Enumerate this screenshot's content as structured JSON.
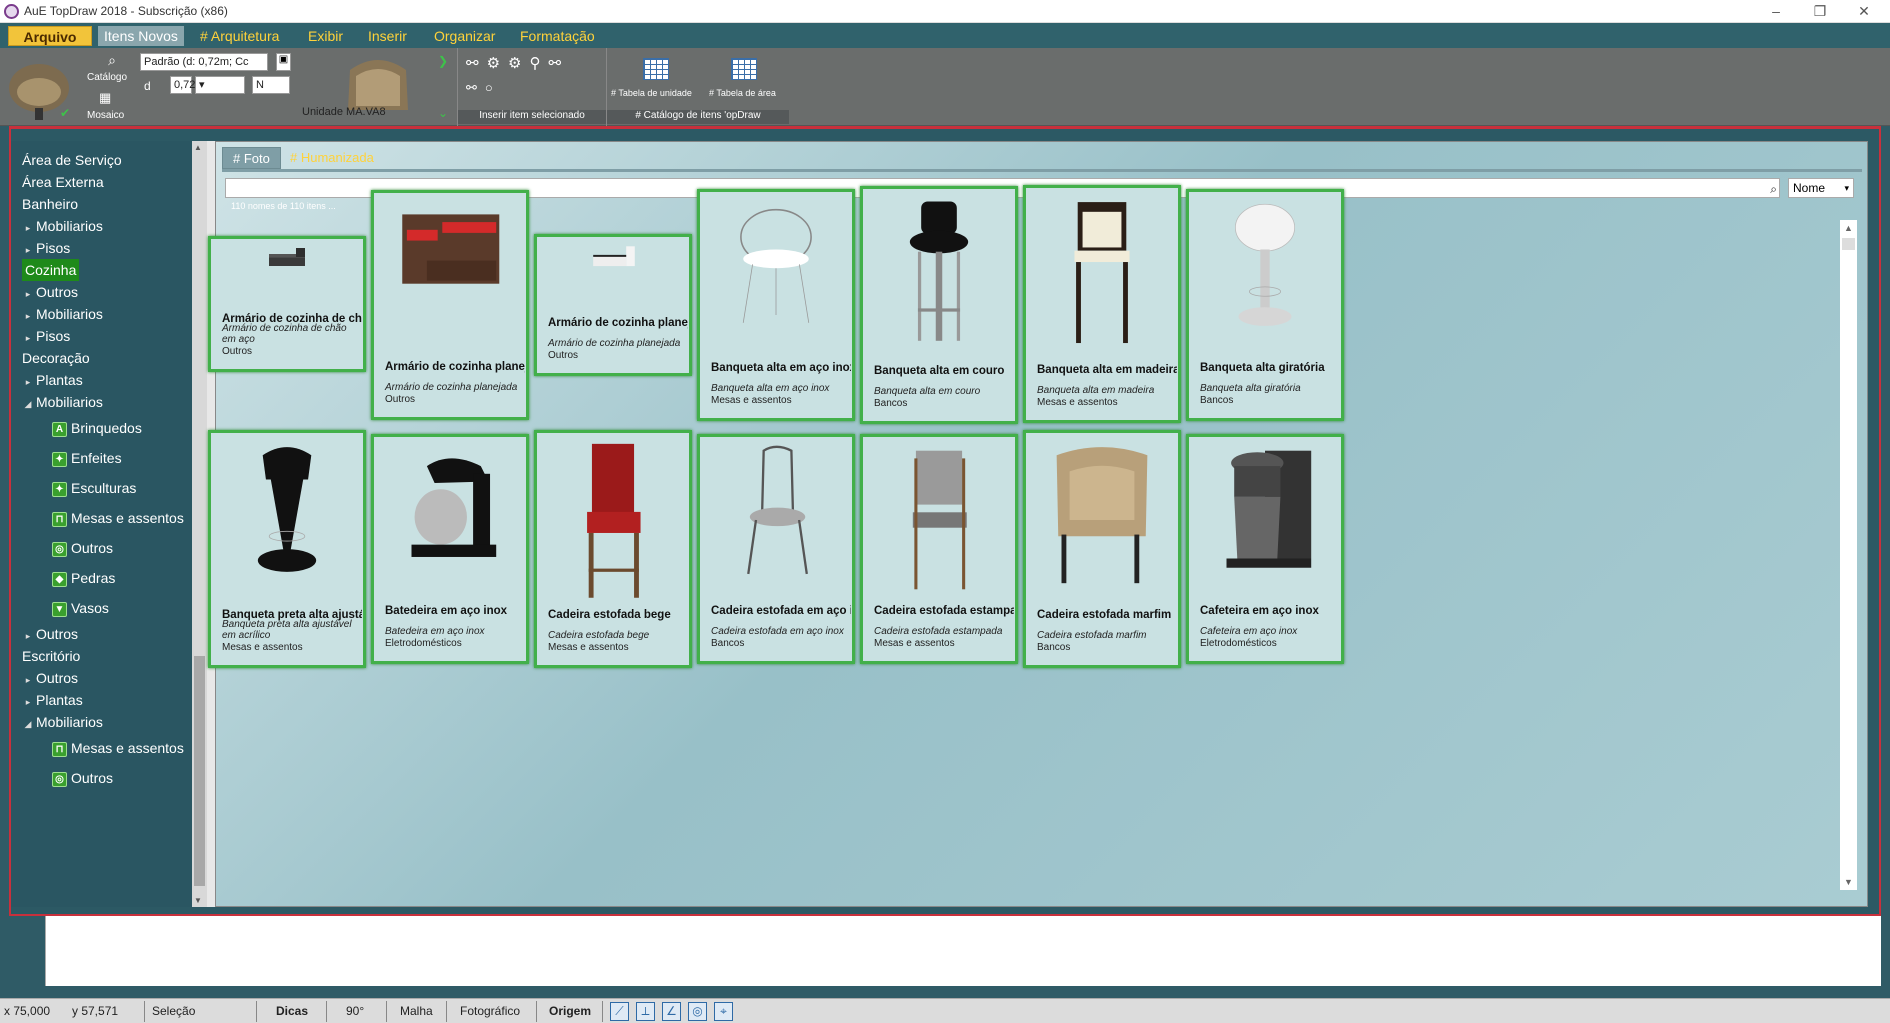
{
  "window": {
    "title": "AuE TopDraw 2018 - Subscrição (x86)",
    "controls": [
      "–",
      "❐",
      "✕"
    ]
  },
  "menu": {
    "items": [
      "Arquivo",
      "Itens Novos",
      "# Arquitetura",
      "Exibir",
      "Inserir",
      "Organizar",
      "Formatação"
    ]
  },
  "quick_access": "↶↷⟳▣ ?",
  "ribbon": {
    "catalog_label": "Catálogo",
    "mosaic_label": "Mosaico",
    "style_combo": "Padrão (d: 0,72m; Cc",
    "d_label": "d",
    "d_value": "0,72",
    "n_value": "N",
    "unit_label": "Unidade MA.VA8",
    "insert_group_label": "Inserir item selecionado",
    "unit_table_label": "# Tabela de unidade",
    "area_table_label": "# Tabela de área",
    "catalog_group_label": "# Catálogo de itens 'opDraw"
  },
  "tree": {
    "items": [
      {
        "label": "Área de Serviço",
        "level": 0
      },
      {
        "label": "Área Externa",
        "level": 0
      },
      {
        "label": "Banheiro",
        "level": 0
      },
      {
        "label": "Mobiliarios",
        "level": 1,
        "arrow": "▸"
      },
      {
        "label": "Pisos",
        "level": 1,
        "arrow": "▸"
      },
      {
        "label": "Cozinha",
        "level": 0,
        "selected": true
      },
      {
        "label": "Outros",
        "level": 1,
        "arrow": "▸"
      },
      {
        "label": "Mobiliarios",
        "level": 1,
        "arrow": "▸"
      },
      {
        "label": "Pisos",
        "level": 1,
        "arrow": "▸"
      },
      {
        "label": "Decoração",
        "level": 0
      },
      {
        "label": "Plantas",
        "level": 1,
        "arrow": "▸"
      },
      {
        "label": "Mobiliarios",
        "level": 1,
        "arrow": "◢"
      },
      {
        "label": "Brinquedos",
        "level": 2,
        "icon": "A"
      },
      {
        "label": "Enfeites",
        "level": 2,
        "icon": "✦"
      },
      {
        "label": "Esculturas",
        "level": 2,
        "icon": "✦"
      },
      {
        "label": "Mesas e assentos",
        "level": 2,
        "icon": "⊓"
      },
      {
        "label": "Outros",
        "level": 2,
        "icon": "◎"
      },
      {
        "label": "Pedras",
        "level": 2,
        "icon": "◆"
      },
      {
        "label": "Vasos",
        "level": 2,
        "icon": "▼"
      },
      {
        "label": "Outros",
        "level": 1,
        "arrow": "▸"
      },
      {
        "label": "Escritório",
        "level": 0
      },
      {
        "label": "Outros",
        "level": 1,
        "arrow": "▸"
      },
      {
        "label": "Plantas",
        "level": 1,
        "arrow": "▸"
      },
      {
        "label": "Mobiliarios",
        "level": 1,
        "arrow": "◢"
      },
      {
        "label": "Mesas e assentos",
        "level": 2,
        "icon": "⊓"
      },
      {
        "label": "Outros",
        "level": 2,
        "icon": "◎"
      }
    ]
  },
  "content": {
    "tab_photo": "# Foto",
    "tab_humanized": "# Humanizada",
    "search_value": "",
    "sort_value": "Nome",
    "count_text": "110 nomes de 110 itens ...",
    "cards": [
      {
        "title": "Armário de cozinha de chão e",
        "desc": "Armário de cozinha de chão em aço",
        "category": "Outros",
        "icon": "kitchen-cabinet-floor"
      },
      {
        "title": "Armário de cozinha planejada",
        "desc": "Armário de cozinha planejada",
        "category": "Outros",
        "icon": "kitchen-cabinet-red"
      },
      {
        "title": "Armário de cozinha planejada",
        "desc": "Armário de cozinha planejada",
        "category": "Outros",
        "icon": "kitchen-cabinet-white"
      },
      {
        "title": "Banqueta alta em aço inox",
        "desc": "Banqueta alta em aço inox",
        "category": "Mesas e assentos",
        "icon": "wire-stool"
      },
      {
        "title": "Banqueta alta em couro",
        "desc": "Banqueta alta em couro",
        "category": "Bancos",
        "icon": "leather-stool"
      },
      {
        "title": "Banqueta alta em madeira",
        "desc": "Banqueta alta em madeira",
        "category": "Mesas e assentos",
        "icon": "wood-stool"
      },
      {
        "title": "Banqueta alta giratória",
        "desc": "Banqueta alta giratória",
        "category": "Bancos",
        "icon": "swivel-stool"
      },
      {
        "title": "Banqueta preta alta ajustável",
        "desc": "Banqueta preta alta ajustável em acrílico",
        "category": "Mesas e assentos",
        "icon": "black-stool"
      },
      {
        "title": "Batedeira em aço inox",
        "desc": "Batedeira em aço inox",
        "category": "Eletrodomésticos",
        "icon": "mixer"
      },
      {
        "title": "Cadeira estofada bege",
        "desc": "Cadeira estofada bege",
        "category": "Mesas e assentos",
        "icon": "red-chair"
      },
      {
        "title": "Cadeira estofada em aço inox",
        "desc": "Cadeira estofada em aço inox",
        "category": "Bancos",
        "icon": "steel-chair"
      },
      {
        "title": "Cadeira estofada estampada",
        "desc": "Cadeira estofada estampada",
        "category": "Mesas e assentos",
        "icon": "patterned-chair"
      },
      {
        "title": "Cadeira estofada marfim",
        "desc": "Cadeira estofada marfim",
        "category": "Bancos",
        "icon": "armchair"
      },
      {
        "title": "Cafeteira em aço inox",
        "desc": "Cafeteira em aço inox",
        "category": "Eletrodomésticos",
        "icon": "coffee-maker"
      }
    ]
  },
  "status": {
    "x": "x 75,000",
    "y": "y 57,571",
    "mode": "Seleção",
    "tips": "Dicas",
    "angle": "90°",
    "grid": "Malha",
    "photo": "Fotográfico",
    "origin": "Origem"
  }
}
